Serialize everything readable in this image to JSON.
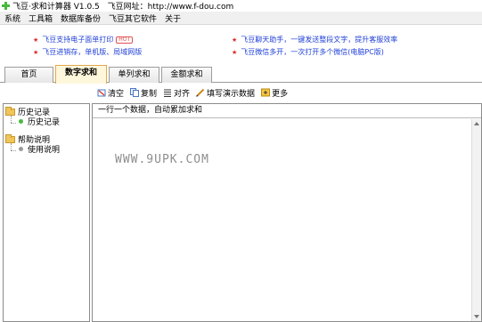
{
  "window": {
    "title": "飞豆·求和计算器 V1.0.5",
    "site": "飞豆网址：http://www.f-dou.com"
  },
  "menu": [
    "系统",
    "工具箱",
    "数据库备份",
    "飞豆其它软件",
    "关于"
  ],
  "ads": {
    "left": [
      "飞豆支持电子面单打印",
      "飞豆进销存，单机版、局域网版"
    ],
    "right": [
      "飞豆聊天助手，一键发送整段文字，提升客服效率",
      "飞豆微信多开，一次打开多个微信(电脑PC版)"
    ],
    "badge": "HOT"
  },
  "tabs": [
    "首页",
    "数字求和",
    "单列求和",
    "金额求和"
  ],
  "active_tab": "数字求和",
  "toolbar": {
    "clear": "清空",
    "copy": "复制",
    "align": "对齐",
    "fill_demo": "填写演示数据",
    "more": "更多"
  },
  "tree": {
    "history_folder": "历史记录",
    "history_item": "历史记录",
    "help_folder": "帮助说明",
    "help_item": "使用说明"
  },
  "editor": {
    "hint": "一行一个数据，自动累加求和"
  },
  "watermark": "WWW.9UPK.COM",
  "colors": {
    "ad_text": "#1f3fd8",
    "active_tab_bg": "#fff7dc",
    "history_dot": "#49b83f",
    "help_dot": "#9a9a9a"
  }
}
